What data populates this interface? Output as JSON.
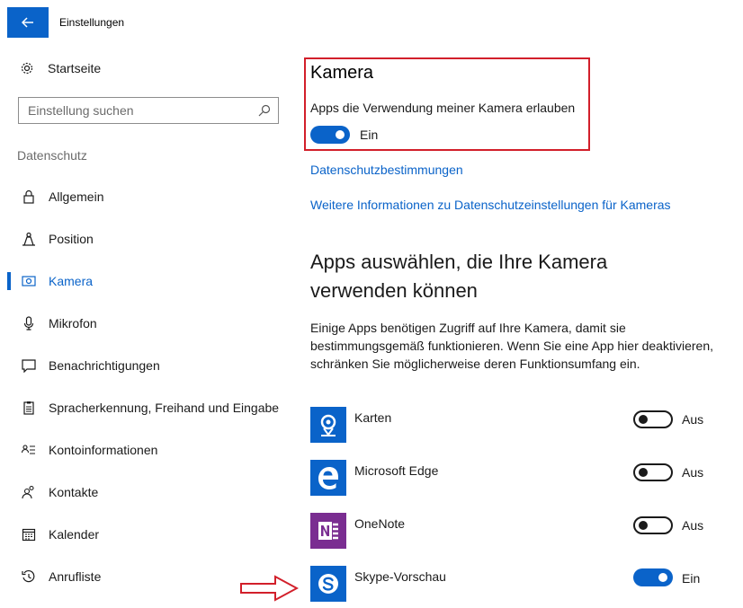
{
  "window": {
    "title": "Einstellungen"
  },
  "sidebar": {
    "home_label": "Startseite",
    "search_placeholder": "Einstellung suchen",
    "section_label": "Datenschutz",
    "items": [
      {
        "label": "Allgemein",
        "icon": "lock-icon"
      },
      {
        "label": "Position",
        "icon": "location-person-icon"
      },
      {
        "label": "Kamera",
        "icon": "camera-icon",
        "active": true
      },
      {
        "label": "Mikrofon",
        "icon": "microphone-icon"
      },
      {
        "label": "Benachrichtigungen",
        "icon": "notification-icon"
      },
      {
        "label": "Spracherkennung, Freihand und Eingabe",
        "icon": "clipboard-icon"
      },
      {
        "label": "Kontoinformationen",
        "icon": "account-info-icon"
      },
      {
        "label": "Kontakte",
        "icon": "contacts-icon"
      },
      {
        "label": "Kalender",
        "icon": "calendar-icon"
      },
      {
        "label": "Anrufliste",
        "icon": "call-history-icon"
      }
    ]
  },
  "main": {
    "title": "Kamera",
    "permission_label": "Apps die Verwendung meiner Kamera erlauben",
    "permission_state": "Ein",
    "links": [
      "Datenschutzbestimmungen",
      "Weitere Informationen zu Datenschutzeinstellungen für Kameras"
    ],
    "apps_heading": "Apps auswählen, die Ihre Kamera verwenden können",
    "description": "Einige Apps benötigen Zugriff auf Ihre Kamera, damit sie bestimmungsgemäß funktionieren. Wenn Sie eine App hier deaktivieren, schränken Sie möglicherweise deren Funktionsumfang ein.",
    "apps": [
      {
        "name": "Karten",
        "state": "Aus",
        "on": false,
        "icon": "maps-app-icon",
        "color": "#0a63c9"
      },
      {
        "name": "Microsoft Edge",
        "state": "Aus",
        "on": false,
        "icon": "edge-app-icon",
        "color": "#0a63c9"
      },
      {
        "name": "OneNote",
        "state": "Aus",
        "on": false,
        "icon": "onenote-app-icon",
        "color": "#7a2d91"
      },
      {
        "name": "Skype-Vorschau",
        "state": "Ein",
        "on": true,
        "icon": "skype-app-icon",
        "color": "#0a63c9"
      }
    ]
  },
  "colors": {
    "accent": "#0a63c9",
    "highlight": "#d21f2a"
  }
}
